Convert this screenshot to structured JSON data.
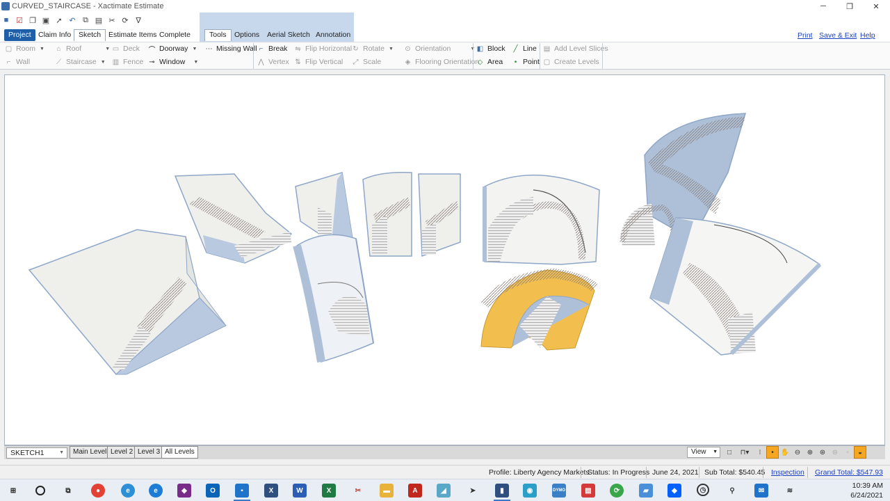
{
  "window": {
    "title": "CURVED_STAIRCASE - Xactimate Estimate",
    "controls": {
      "minimize": "─",
      "restore": "❐",
      "close": "✕"
    }
  },
  "quick_access": {
    "icons": [
      "camera-icon",
      "checklist-icon",
      "copy-doc-icon",
      "save-icon",
      "pointer-icon",
      "undo-icon",
      "copy-icon",
      "paste-icon",
      "cut-icon",
      "redo-icon",
      "v-logo-icon"
    ]
  },
  "tabs": {
    "project": "Project",
    "claim_info": "Claim Info",
    "sketch": "Sketch",
    "estimate_items": "Estimate Items",
    "complete": "Complete",
    "tools": "Tools",
    "options": "Options",
    "aerial_sketch": "Aerial Sketch",
    "annotation": "Annotation"
  },
  "top_links": {
    "print": "Print",
    "save_exit": "Save & Exit",
    "help": "Help"
  },
  "ribbon": {
    "room": "Room",
    "wall": "Wall",
    "roof": "Roof",
    "staircase": "Staircase",
    "deck": "Deck",
    "fence": "Fence",
    "doorway": "Doorway",
    "window": "Window",
    "missing_wall": "Missing Wall",
    "break": "Break",
    "vertex": "Vertex",
    "flip_horizontal": "Flip Horizontal",
    "flip_vertical": "Flip Vertical",
    "rotate": "Rotate",
    "scale": "Scale",
    "orientation": "Orientation",
    "flooring_orientation": "Flooring Orientation",
    "block": "Block",
    "area": "Area",
    "line": "Line",
    "point": "Point",
    "add_level_slices": "Add Level Slices",
    "create_levels": "Create Levels"
  },
  "sketch_bar": {
    "sketch_name": "SKETCH1",
    "levels": [
      "Main Level",
      "Level 2",
      "Level 3",
      "All Levels"
    ],
    "active_level": "All Levels",
    "view_label": "View"
  },
  "status": {
    "profile": "Profile:  Liberty Agency Markets",
    "status": "Status:  In Progress",
    "date": "June 24, 2021",
    "sub_total": "Sub Total: $540.45",
    "inspection": "Inspection",
    "grand_total": "Grand Total: $547.93"
  },
  "taskbar": {
    "time": "10:39 AM",
    "date": "6/24/2021"
  },
  "colors": {
    "accent_blue": "#1f5fa8",
    "tab_group_bg": "#c8d8ec",
    "highlight_orange": "#f5a623",
    "stair_yellow": "#f2be4e",
    "wall_blue": "#aebfd8"
  }
}
